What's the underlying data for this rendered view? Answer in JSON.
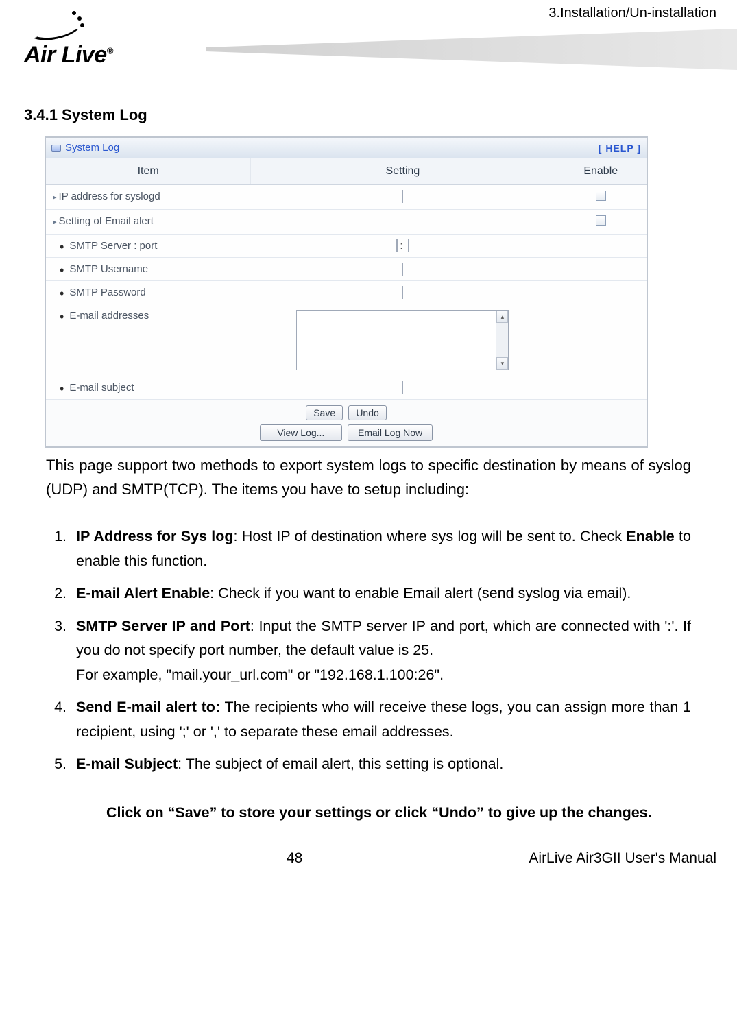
{
  "header": {
    "breadcrumb": "3.Installation/Un-installation",
    "logo_text": "Air Live",
    "reg_mark": "®"
  },
  "section": {
    "heading": "3.4.1 System Log"
  },
  "panel": {
    "title": "System Log",
    "help_link": "[ HELP ]",
    "headers": {
      "item": "Item",
      "setting": "Setting",
      "enable": "Enable"
    },
    "rows": {
      "ip_syslogd": "IP address for syslogd",
      "email_alert": "Setting of Email alert",
      "smtp_server": "SMTP Server : port",
      "smtp_username": "SMTP Username",
      "smtp_password": "SMTP Password",
      "email_addresses": "E-mail addresses",
      "email_subject": "E-mail subject"
    },
    "buttons": {
      "save": "Save",
      "undo": "Undo",
      "view_log": "View Log...",
      "email_log_now": "Email Log Now"
    }
  },
  "intro_text": "This page support two methods to export system logs to specific destination by means of syslog (UDP) and SMTP(TCP). The items you have to setup including:",
  "list": {
    "i1_bold": "IP Address for Sys log",
    "i1_rest": ": Host IP of destination where sys log will be sent to. Check ",
    "i1_bold2": "Enable",
    "i1_rest2": " to enable this function.",
    "i2_bold": "E-mail Alert Enable",
    "i2_rest": ": Check if you want to enable Email alert (send syslog via email).",
    "i3_bold": "SMTP Server IP and Port",
    "i3_rest": ": Input the SMTP server IP and port, which are connected with ':'. If you do not specify port number, the default value is 25.",
    "i3_line2": "For example, \"mail.your_url.com\" or \"192.168.1.100:26\".",
    "i4_bold": "Send E-mail alert to:",
    "i4_rest": " The recipients who will receive these logs, you can assign more than 1 recipient, using ';' or ',' to separate these email addresses.",
    "i5_bold": "E-mail Subject",
    "i5_rest": ": The subject of email alert, this setting is optional."
  },
  "closing_text": "Click on “Save” to store your settings or click “Undo” to give up the changes.",
  "footer": {
    "page": "48",
    "manual": "AirLive Air3GII User's Manual"
  }
}
